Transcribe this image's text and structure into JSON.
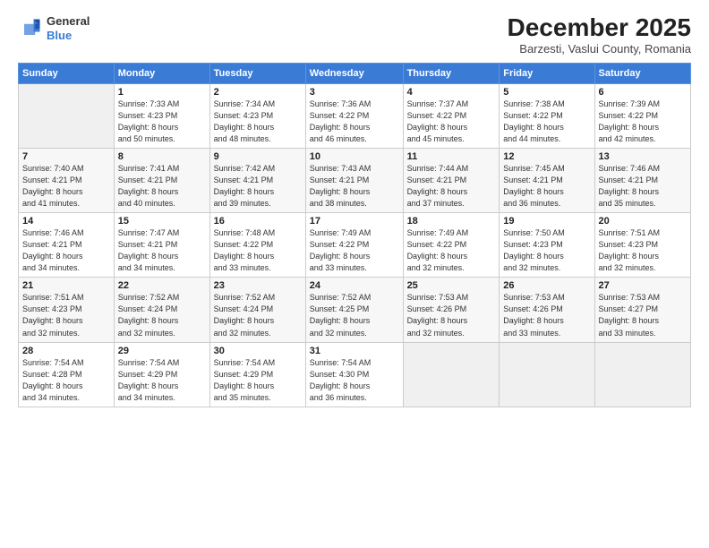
{
  "logo": {
    "general": "General",
    "blue": "Blue"
  },
  "title": "December 2025",
  "subtitle": "Barzesti, Vaslui County, Romania",
  "weekdays": [
    "Sunday",
    "Monday",
    "Tuesday",
    "Wednesday",
    "Thursday",
    "Friday",
    "Saturday"
  ],
  "weeks": [
    [
      {
        "day": "",
        "sunrise": "",
        "sunset": "",
        "daylight": ""
      },
      {
        "day": "1",
        "sunrise": "Sunrise: 7:33 AM",
        "sunset": "Sunset: 4:23 PM",
        "daylight": "Daylight: 8 hours and 50 minutes."
      },
      {
        "day": "2",
        "sunrise": "Sunrise: 7:34 AM",
        "sunset": "Sunset: 4:23 PM",
        "daylight": "Daylight: 8 hours and 48 minutes."
      },
      {
        "day": "3",
        "sunrise": "Sunrise: 7:36 AM",
        "sunset": "Sunset: 4:22 PM",
        "daylight": "Daylight: 8 hours and 46 minutes."
      },
      {
        "day": "4",
        "sunrise": "Sunrise: 7:37 AM",
        "sunset": "Sunset: 4:22 PM",
        "daylight": "Daylight: 8 hours and 45 minutes."
      },
      {
        "day": "5",
        "sunrise": "Sunrise: 7:38 AM",
        "sunset": "Sunset: 4:22 PM",
        "daylight": "Daylight: 8 hours and 44 minutes."
      },
      {
        "day": "6",
        "sunrise": "Sunrise: 7:39 AM",
        "sunset": "Sunset: 4:22 PM",
        "daylight": "Daylight: 8 hours and 42 minutes."
      }
    ],
    [
      {
        "day": "7",
        "sunrise": "Sunrise: 7:40 AM",
        "sunset": "Sunset: 4:21 PM",
        "daylight": "Daylight: 8 hours and 41 minutes."
      },
      {
        "day": "8",
        "sunrise": "Sunrise: 7:41 AM",
        "sunset": "Sunset: 4:21 PM",
        "daylight": "Daylight: 8 hours and 40 minutes."
      },
      {
        "day": "9",
        "sunrise": "Sunrise: 7:42 AM",
        "sunset": "Sunset: 4:21 PM",
        "daylight": "Daylight: 8 hours and 39 minutes."
      },
      {
        "day": "10",
        "sunrise": "Sunrise: 7:43 AM",
        "sunset": "Sunset: 4:21 PM",
        "daylight": "Daylight: 8 hours and 38 minutes."
      },
      {
        "day": "11",
        "sunrise": "Sunrise: 7:44 AM",
        "sunset": "Sunset: 4:21 PM",
        "daylight": "Daylight: 8 hours and 37 minutes."
      },
      {
        "day": "12",
        "sunrise": "Sunrise: 7:45 AM",
        "sunset": "Sunset: 4:21 PM",
        "daylight": "Daylight: 8 hours and 36 minutes."
      },
      {
        "day": "13",
        "sunrise": "Sunrise: 7:46 AM",
        "sunset": "Sunset: 4:21 PM",
        "daylight": "Daylight: 8 hours and 35 minutes."
      }
    ],
    [
      {
        "day": "14",
        "sunrise": "Sunrise: 7:46 AM",
        "sunset": "Sunset: 4:21 PM",
        "daylight": "Daylight: 8 hours and 34 minutes."
      },
      {
        "day": "15",
        "sunrise": "Sunrise: 7:47 AM",
        "sunset": "Sunset: 4:21 PM",
        "daylight": "Daylight: 8 hours and 34 minutes."
      },
      {
        "day": "16",
        "sunrise": "Sunrise: 7:48 AM",
        "sunset": "Sunset: 4:22 PM",
        "daylight": "Daylight: 8 hours and 33 minutes."
      },
      {
        "day": "17",
        "sunrise": "Sunrise: 7:49 AM",
        "sunset": "Sunset: 4:22 PM",
        "daylight": "Daylight: 8 hours and 33 minutes."
      },
      {
        "day": "18",
        "sunrise": "Sunrise: 7:49 AM",
        "sunset": "Sunset: 4:22 PM",
        "daylight": "Daylight: 8 hours and 32 minutes."
      },
      {
        "day": "19",
        "sunrise": "Sunrise: 7:50 AM",
        "sunset": "Sunset: 4:23 PM",
        "daylight": "Daylight: 8 hours and 32 minutes."
      },
      {
        "day": "20",
        "sunrise": "Sunrise: 7:51 AM",
        "sunset": "Sunset: 4:23 PM",
        "daylight": "Daylight: 8 hours and 32 minutes."
      }
    ],
    [
      {
        "day": "21",
        "sunrise": "Sunrise: 7:51 AM",
        "sunset": "Sunset: 4:23 PM",
        "daylight": "Daylight: 8 hours and 32 minutes."
      },
      {
        "day": "22",
        "sunrise": "Sunrise: 7:52 AM",
        "sunset": "Sunset: 4:24 PM",
        "daylight": "Daylight: 8 hours and 32 minutes."
      },
      {
        "day": "23",
        "sunrise": "Sunrise: 7:52 AM",
        "sunset": "Sunset: 4:24 PM",
        "daylight": "Daylight: 8 hours and 32 minutes."
      },
      {
        "day": "24",
        "sunrise": "Sunrise: 7:52 AM",
        "sunset": "Sunset: 4:25 PM",
        "daylight": "Daylight: 8 hours and 32 minutes."
      },
      {
        "day": "25",
        "sunrise": "Sunrise: 7:53 AM",
        "sunset": "Sunset: 4:26 PM",
        "daylight": "Daylight: 8 hours and 32 minutes."
      },
      {
        "day": "26",
        "sunrise": "Sunrise: 7:53 AM",
        "sunset": "Sunset: 4:26 PM",
        "daylight": "Daylight: 8 hours and 33 minutes."
      },
      {
        "day": "27",
        "sunrise": "Sunrise: 7:53 AM",
        "sunset": "Sunset: 4:27 PM",
        "daylight": "Daylight: 8 hours and 33 minutes."
      }
    ],
    [
      {
        "day": "28",
        "sunrise": "Sunrise: 7:54 AM",
        "sunset": "Sunset: 4:28 PM",
        "daylight": "Daylight: 8 hours and 34 minutes."
      },
      {
        "day": "29",
        "sunrise": "Sunrise: 7:54 AM",
        "sunset": "Sunset: 4:29 PM",
        "daylight": "Daylight: 8 hours and 34 minutes."
      },
      {
        "day": "30",
        "sunrise": "Sunrise: 7:54 AM",
        "sunset": "Sunset: 4:29 PM",
        "daylight": "Daylight: 8 hours and 35 minutes."
      },
      {
        "day": "31",
        "sunrise": "Sunrise: 7:54 AM",
        "sunset": "Sunset: 4:30 PM",
        "daylight": "Daylight: 8 hours and 36 minutes."
      },
      {
        "day": "",
        "sunrise": "",
        "sunset": "",
        "daylight": ""
      },
      {
        "day": "",
        "sunrise": "",
        "sunset": "",
        "daylight": ""
      },
      {
        "day": "",
        "sunrise": "",
        "sunset": "",
        "daylight": ""
      }
    ]
  ]
}
